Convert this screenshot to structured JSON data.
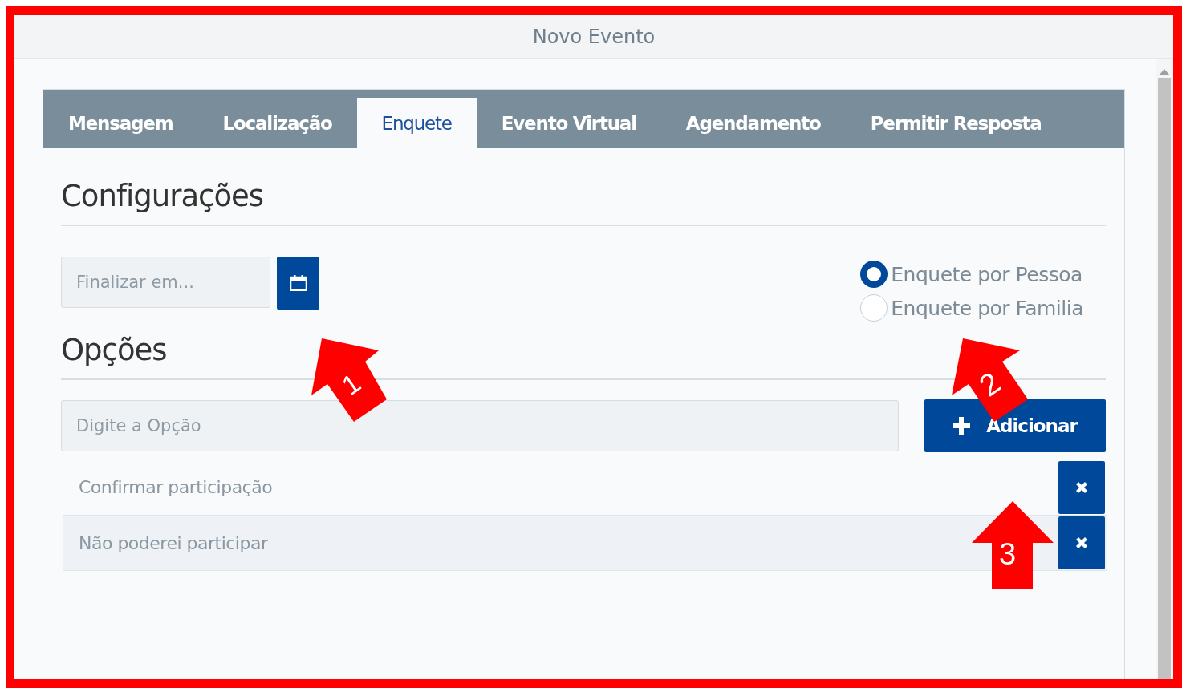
{
  "window": {
    "title": "Novo Evento"
  },
  "tabs": [
    {
      "label": "Mensagem",
      "selected": false
    },
    {
      "label": "Localização",
      "selected": false
    },
    {
      "label": "Enquete",
      "selected": true
    },
    {
      "label": "Evento Virtual",
      "selected": false
    },
    {
      "label": "Agendamento",
      "selected": false
    },
    {
      "label": "Permitir Resposta",
      "selected": false
    }
  ],
  "settings": {
    "heading": "Configurações",
    "end_date": {
      "placeholder": "Finalizar em..."
    },
    "poll_type": [
      {
        "label": "Enquete por Pessoa",
        "selected": true
      },
      {
        "label": "Enquete por Familia",
        "selected": false
      }
    ]
  },
  "options": {
    "heading": "Opções",
    "new_option": {
      "placeholder": "Digite a Opção"
    },
    "add_button": "Adicionar",
    "items": [
      "Confirmar participação",
      "Não poderei participar"
    ]
  },
  "annotations": [
    {
      "label": "1"
    },
    {
      "label": "2"
    },
    {
      "label": "3"
    }
  ]
}
